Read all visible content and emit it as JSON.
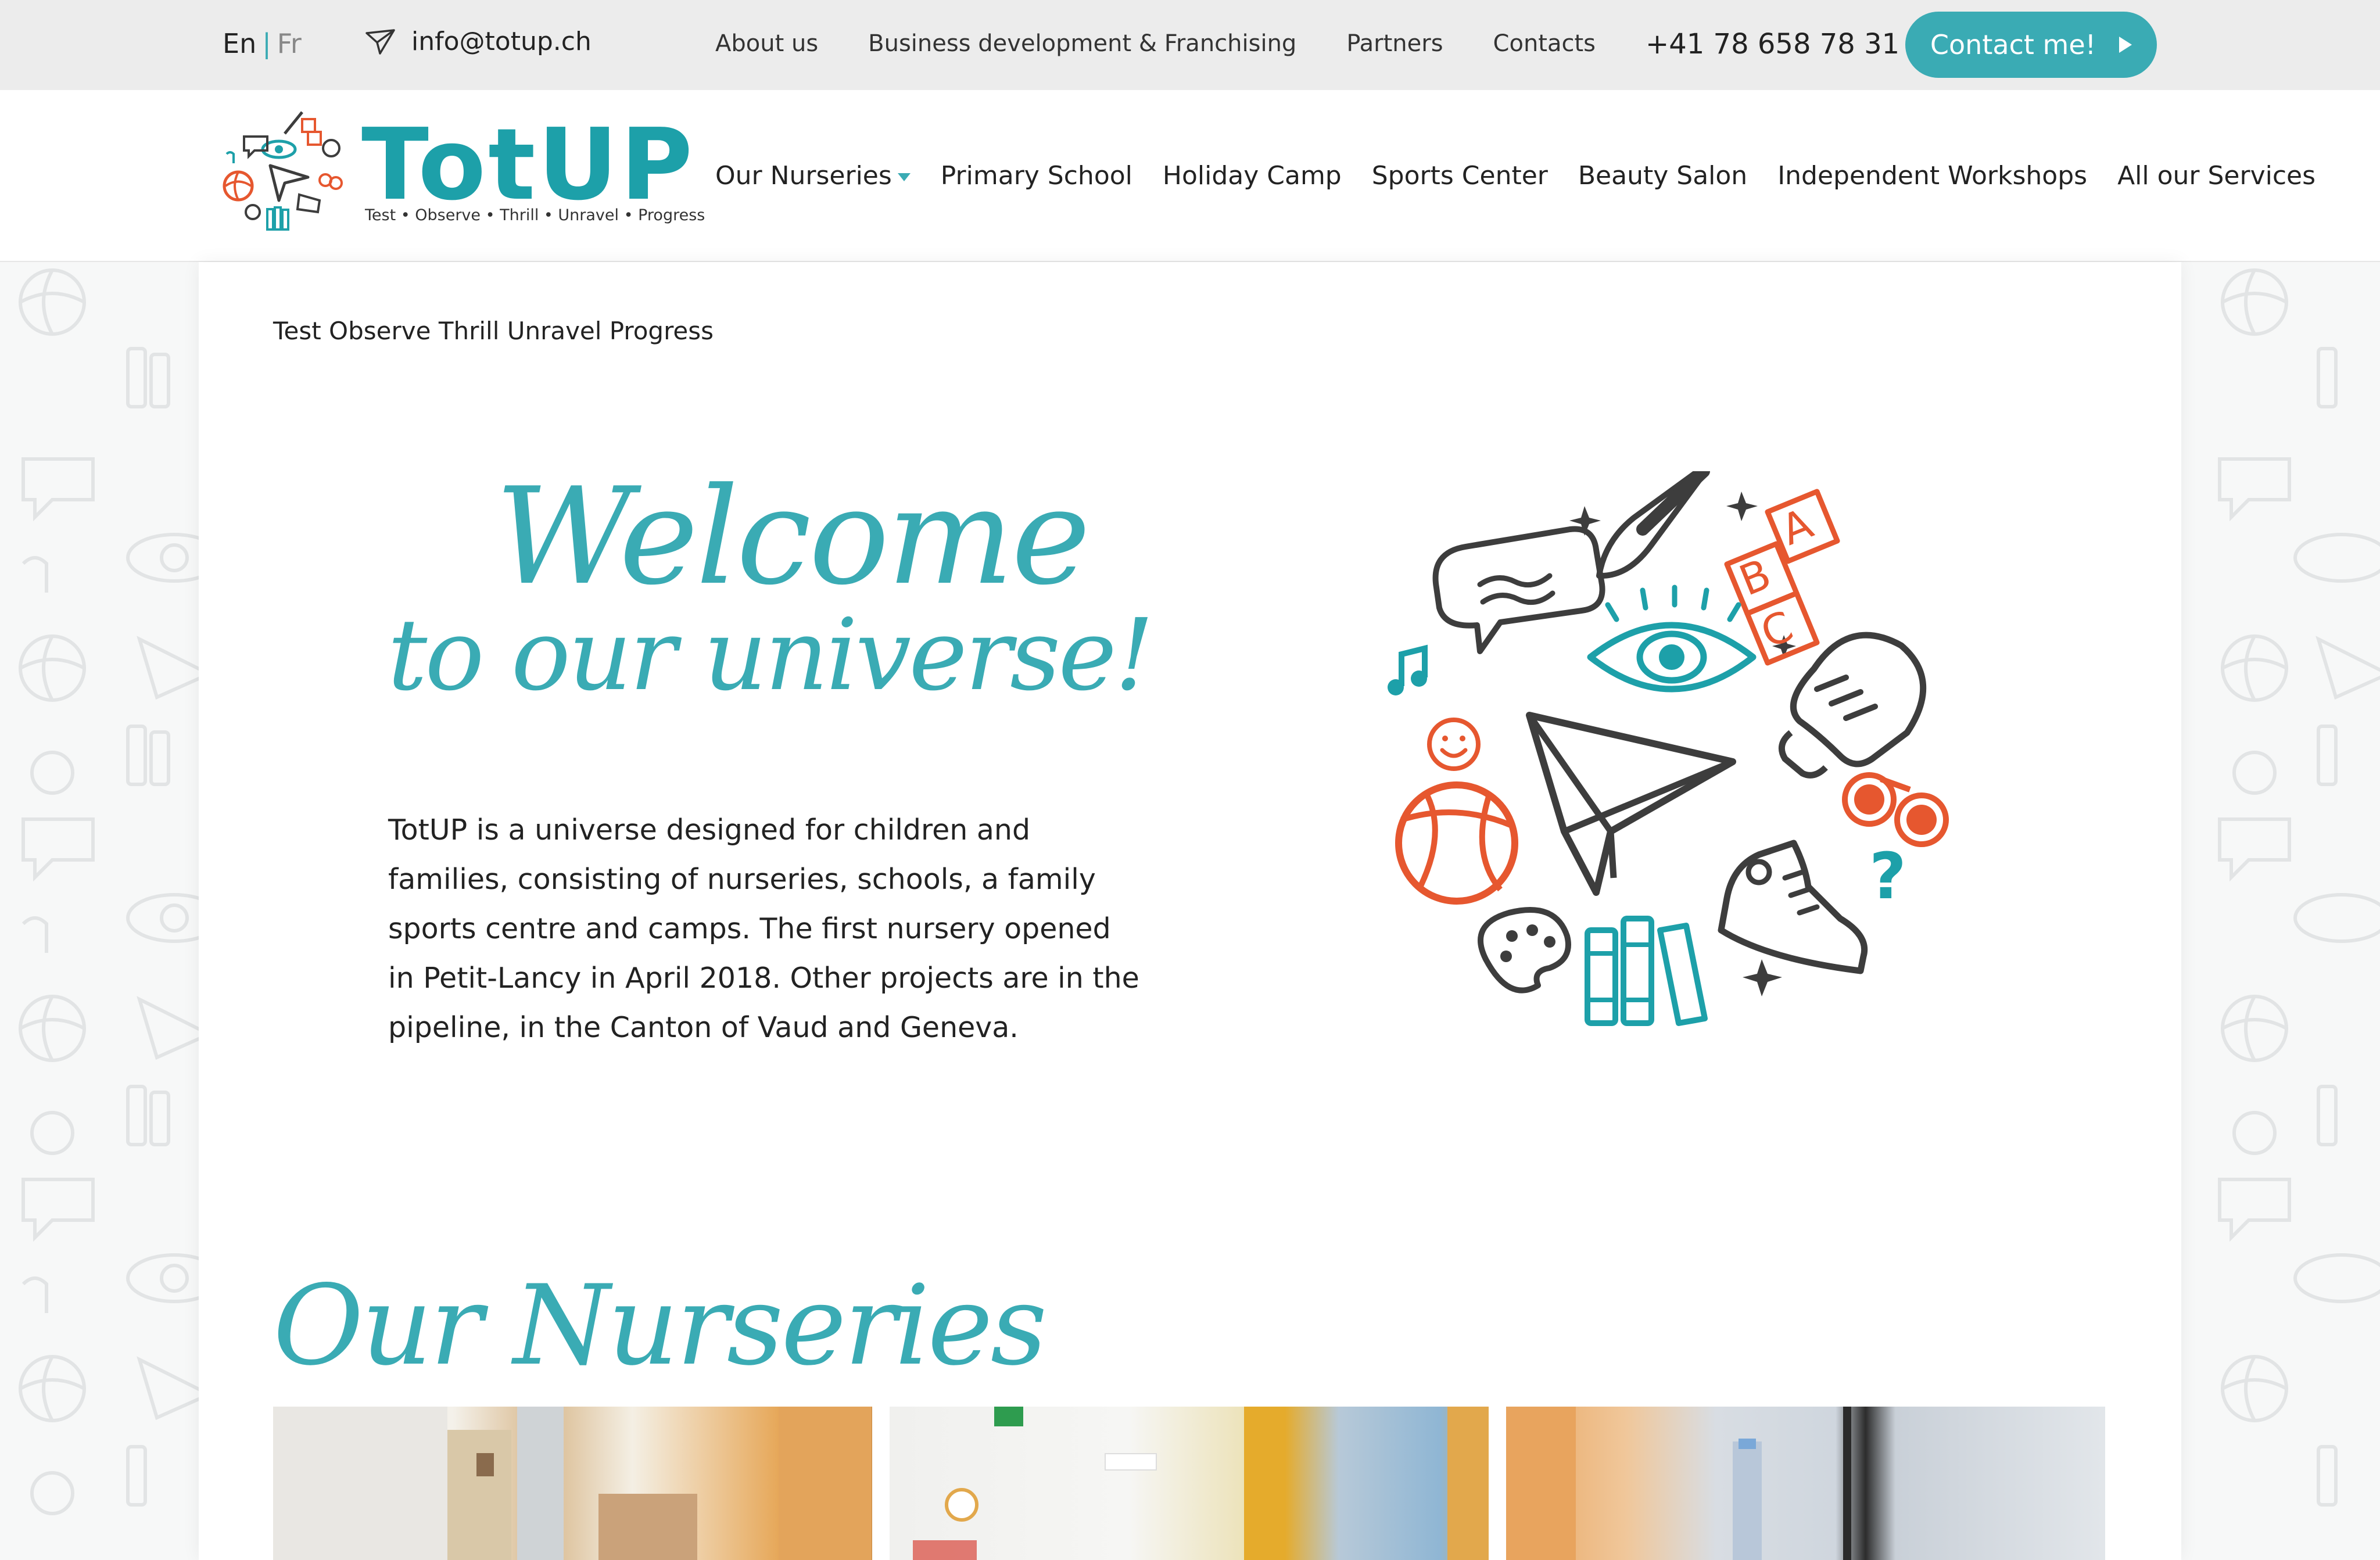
{
  "topbar": {
    "lang_en": "En",
    "lang_sep": "|",
    "lang_fr": "Fr",
    "email": "info@totup.ch",
    "links": [
      "About us",
      "Business development & Franchising",
      "Partners",
      "Contacts"
    ],
    "phone": "+41 78 658 78 31",
    "contact_button": "Contact me!"
  },
  "header": {
    "logo_word": "TotUP",
    "logo_tagline": "Test • Observe • Thrill • Unravel • Progress",
    "nav": [
      "Our Nurseries",
      "Primary School",
      "Holiday Camp",
      "Sports Center",
      "Beauty Salon",
      "Independent Workshops",
      "All our Services"
    ]
  },
  "main": {
    "breadcrumb": "Test Observe Thrill Unravel Progress",
    "welcome_line1": "Welcome",
    "welcome_line2": "to our universe!",
    "intro": "TotUP is a universe designed for children and families, consisting of nurseries, schools, a family sports centre and camps. The first nursery opened in Petit-Lancy in April 2018. Other projects are in the pipeline, in the Canton of Vaud and Geneva.",
    "section_title": "Our Nurseries",
    "illustration_blocks": [
      "A",
      "B",
      "C"
    ],
    "illustration_question": "?"
  },
  "colors": {
    "accent": "#3aabb4",
    "logo": "#1da0a9",
    "orange": "#e6572f",
    "dark": "#3d3d3d"
  }
}
